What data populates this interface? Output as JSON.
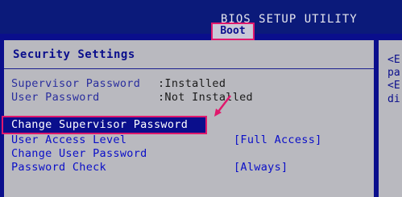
{
  "header": {
    "title": "BIOS SETUP UTILITY",
    "active_tab": "Boot"
  },
  "section": {
    "title": "Security Settings"
  },
  "status": [
    {
      "label": "Supervisor Password",
      "value": ":Installed"
    },
    {
      "label": "User Password",
      "value": ":Not Installed"
    }
  ],
  "options": [
    {
      "label": "Change Supervisor Password",
      "value": ""
    },
    {
      "label": "User Access Level",
      "value": "[Full Access]"
    },
    {
      "label": "Change User Password",
      "value": ""
    },
    {
      "label": "Password Check",
      "value": "[Always]"
    }
  ],
  "help": {
    "lines": [
      "<E",
      "pa",
      "<E",
      "di"
    ]
  },
  "colors": {
    "highlight": "#e0186c",
    "bios_blue": "#0a0e8c",
    "panel_gray": "#b9b9bf"
  }
}
